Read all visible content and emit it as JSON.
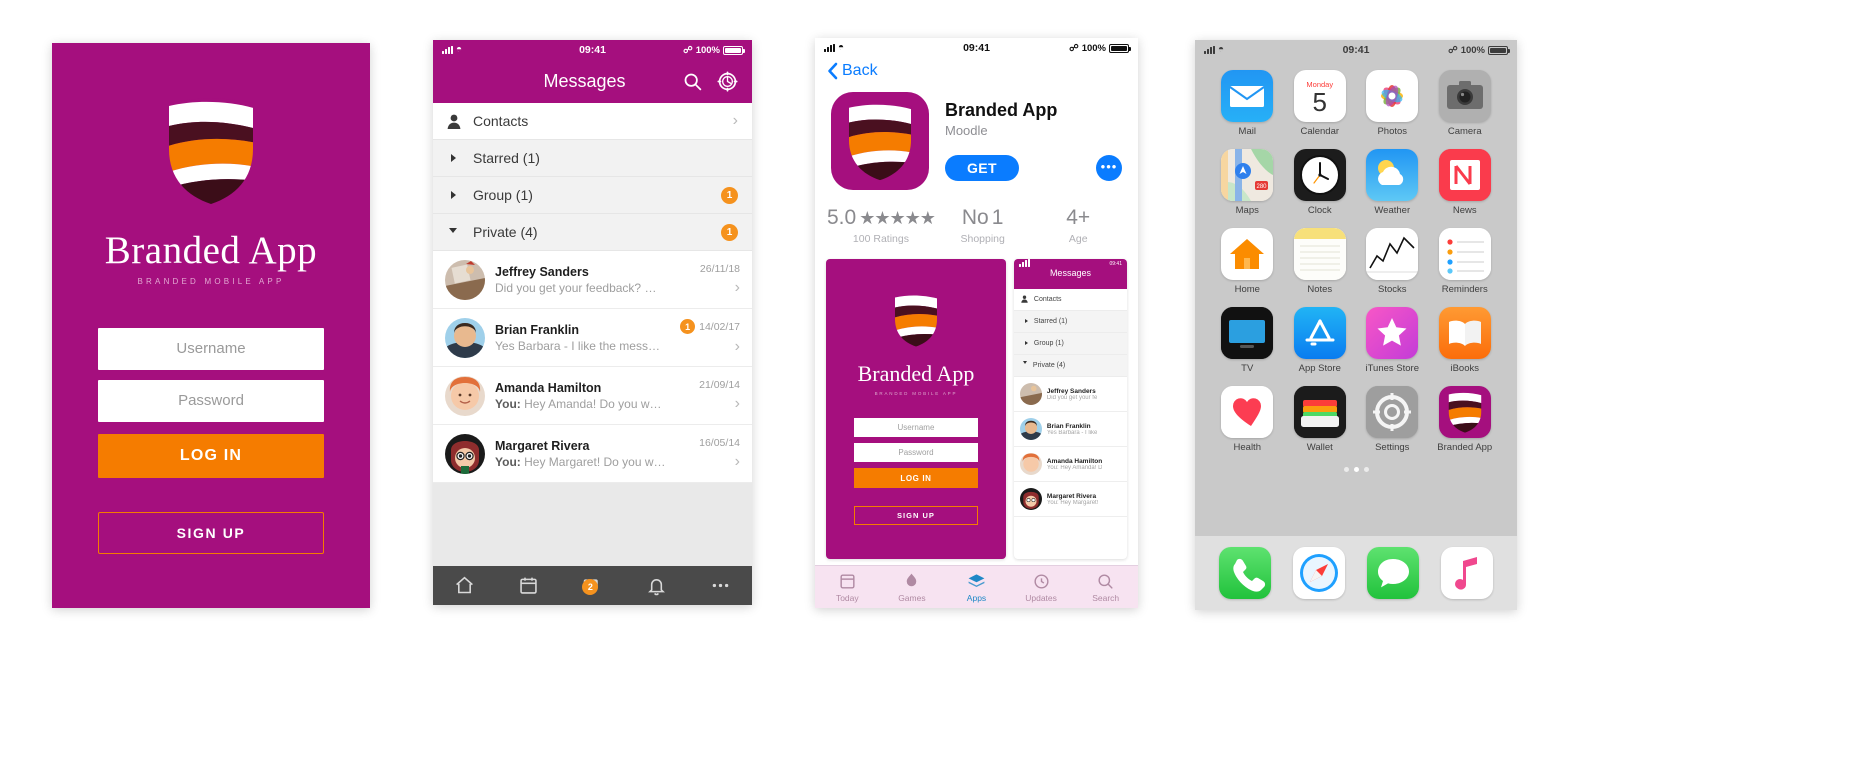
{
  "login_screen": {
    "brand_title": "Branded App",
    "brand_subtitle": "BRANDED MOBILE APP",
    "username_placeholder": "Username",
    "password_placeholder": "Password",
    "login_label": "LOG IN",
    "signup_label": "SIGN UP",
    "bg_color": "#a50f7e",
    "accent_color": "#f57c00"
  },
  "messages_screen": {
    "status": {
      "time": "09:41",
      "battery": "100%"
    },
    "title": "Messages",
    "icons": {
      "search": "search-icon",
      "settings": "gear-icon"
    },
    "sections": [
      {
        "label": "Contacts",
        "type": "contacts",
        "badge": ""
      },
      {
        "label": "Starred (1)",
        "type": "collapsed",
        "badge": ""
      },
      {
        "label": "Group (1)",
        "type": "collapsed",
        "badge": "1"
      },
      {
        "label": "Private (4)",
        "type": "expanded",
        "badge": "1"
      }
    ],
    "threads": [
      {
        "name": "Jeffrey Sanders",
        "prefix": "",
        "preview": "Did you get your feedback? Was it u...",
        "date": "26/11/18",
        "badge": ""
      },
      {
        "name": "Brian Franklin",
        "prefix": "",
        "preview": "Yes Barbara - I like the messaging to...",
        "date": "14/02/17",
        "badge": "1"
      },
      {
        "name": "Amanda Hamilton",
        "prefix": "You:",
        "preview": "Hey Amanda! Do you want to co...",
        "date": "21/09/14",
        "badge": ""
      },
      {
        "name": "Margaret Rivera",
        "prefix": "You:",
        "preview": "Hey Margaret! Do you want to c...",
        "date": "16/05/14",
        "badge": ""
      }
    ],
    "tabbar": [
      {
        "icon": "home-icon",
        "badge": ""
      },
      {
        "icon": "calendar-icon",
        "badge": ""
      },
      {
        "icon": "chat-icon",
        "badge": "2"
      },
      {
        "icon": "bell-icon",
        "badge": ""
      },
      {
        "icon": "more-icon",
        "badge": ""
      }
    ]
  },
  "appstore_screen": {
    "status": {
      "time": "09:41",
      "battery": "100%"
    },
    "back_label": "Back",
    "app_name": "Branded App",
    "developer": "Moodle",
    "get_label": "GET",
    "more_label": "•••",
    "stats": [
      {
        "value": "5.0",
        "stars": "★★★★★",
        "sub": "100 Ratings"
      },
      {
        "value": "No",
        "sup": "1",
        "sub": "Shopping"
      },
      {
        "value": "4+",
        "sub": "Age"
      }
    ],
    "screenshot_login": {
      "brand_title": "Branded App",
      "brand_subtitle": "BRANDED MOBILE APP",
      "username_placeholder": "Username",
      "password_placeholder": "Password",
      "login_label": "LOG IN",
      "signup_label": "SIGN UP"
    },
    "screenshot_messages": {
      "time": "09:41",
      "title": "Messages",
      "sections": [
        "Contacts",
        "Starred (1)",
        "Group (1)",
        "Private (4)"
      ],
      "threads": [
        {
          "name": "Jeffrey Sanders",
          "preview": "Did you get your fe"
        },
        {
          "name": "Brian Franklin",
          "preview": "Yes Barbara - I like"
        },
        {
          "name": "Amanda Hamilton",
          "preview": "You: Hey Amanda! D"
        },
        {
          "name": "Margaret Rivera",
          "preview": "You: Hey Margaret!"
        }
      ]
    },
    "tabbar": [
      {
        "label": "Today",
        "active": false
      },
      {
        "label": "Games",
        "active": false
      },
      {
        "label": "Apps",
        "active": true
      },
      {
        "label": "Updates",
        "active": false
      },
      {
        "label": "Search",
        "active": false
      }
    ]
  },
  "home_screen": {
    "status": {
      "time": "09:41",
      "battery": "100%"
    },
    "apps": [
      {
        "label": "Mail",
        "icon": "mail-icon"
      },
      {
        "label": "Calendar",
        "icon": "calendar-icon",
        "day": "Monday",
        "date": "5"
      },
      {
        "label": "Photos",
        "icon": "photos-icon"
      },
      {
        "label": "Camera",
        "icon": "camera-icon"
      },
      {
        "label": "Maps",
        "icon": "maps-icon"
      },
      {
        "label": "Clock",
        "icon": "clock-icon"
      },
      {
        "label": "Weather",
        "icon": "weather-icon"
      },
      {
        "label": "News",
        "icon": "news-icon"
      },
      {
        "label": "Home",
        "icon": "home-icon"
      },
      {
        "label": "Notes",
        "icon": "notes-icon"
      },
      {
        "label": "Stocks",
        "icon": "stocks-icon"
      },
      {
        "label": "Reminders",
        "icon": "reminders-icon"
      },
      {
        "label": "TV",
        "icon": "tv-icon"
      },
      {
        "label": "App Store",
        "icon": "appstore-icon"
      },
      {
        "label": "iTunes Store",
        "icon": "itunes-icon"
      },
      {
        "label": "iBooks",
        "icon": "ibooks-icon"
      },
      {
        "label": "Health",
        "icon": "health-icon"
      },
      {
        "label": "Wallet",
        "icon": "wallet-icon"
      },
      {
        "label": "Settings",
        "icon": "settings-icon"
      },
      {
        "label": "Branded App",
        "icon": "branded-app-icon"
      }
    ],
    "page_dots": 3,
    "active_dot": 2,
    "dock": [
      {
        "label": "Phone",
        "icon": "phone-icon"
      },
      {
        "label": "Safari",
        "icon": "safari-icon"
      },
      {
        "label": "Messages",
        "icon": "messages-icon"
      },
      {
        "label": "Music",
        "icon": "music-icon"
      }
    ]
  }
}
